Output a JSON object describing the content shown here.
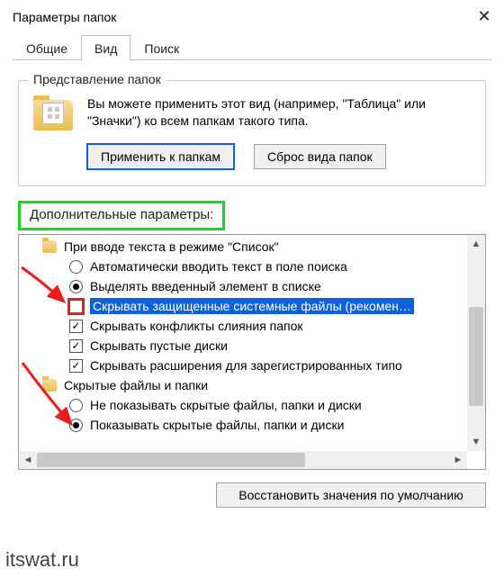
{
  "window": {
    "title": "Параметры папок"
  },
  "tabs": {
    "t0": "Общие",
    "t1": "Вид",
    "t2": "Поиск",
    "active": 1
  },
  "group": {
    "legend": "Представление папок",
    "desc": "Вы можете применить этот вид (например, \"Таблица\" или \"Значки\") ко всем папкам такого типа.",
    "apply": "Применить к папкам",
    "reset": "Сброс вида папок"
  },
  "adv": {
    "label": "Дополнительные параметры:",
    "items": {
      "i0": "При вводе текста в режиме \"Список\"",
      "i1": "Автоматически вводить текст в поле поиска",
      "i2": "Выделять введенный элемент в списке",
      "i3": "Скрывать защищенные системные файлы (рекомен…",
      "i4": "Скрывать конфликты слияния папок",
      "i5": "Скрывать пустые диски",
      "i6": "Скрывать расширения для зарегистрированных типо",
      "i7": "Скрытые файлы и папки",
      "i8": "Не показывать скрытые файлы, папки и диски",
      "i9": "Показывать скрытые файлы, папки и диски"
    }
  },
  "restore": "Восстановить значения по умолчанию",
  "watermark": "itswat.ru"
}
